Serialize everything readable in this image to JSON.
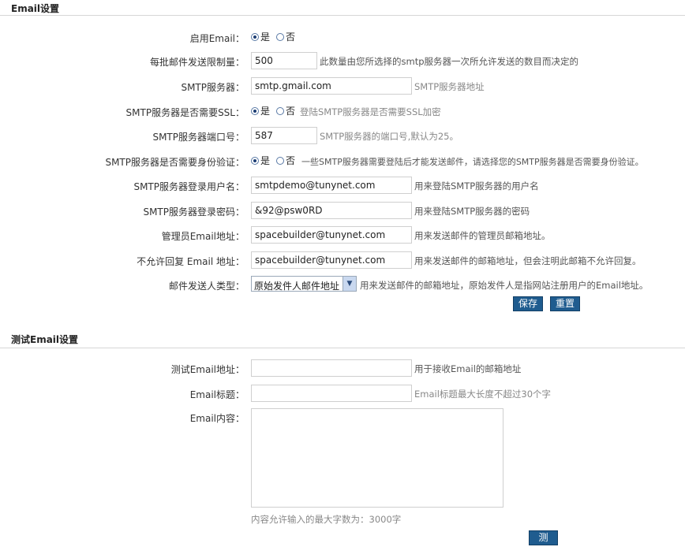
{
  "email_settings": {
    "section_title": "Email设置",
    "enable": {
      "label": "启用Email：",
      "options": [
        "是",
        "否"
      ],
      "selected": 0
    },
    "batch_limit": {
      "label": "每批邮件发送限制量：",
      "value": "500",
      "hint": "此数量由您所选择的smtp服务器一次所允许发送的数目而决定的"
    },
    "smtp_server": {
      "label": "SMTP服务器：",
      "value": "smtp.gmail.com",
      "hint": "SMTP服务器地址"
    },
    "ssl": {
      "label": "SMTP服务器是否需要SSL：",
      "options": [
        "是",
        "否"
      ],
      "selected": 0,
      "hint": "登陆SMTP服务器是否需要SSL加密"
    },
    "port": {
      "label": "SMTP服务器端口号：",
      "value": "587",
      "hint": "SMTP服务器的端口号,默认为25。"
    },
    "auth": {
      "label": "SMTP服务器是否需要身份验证：",
      "options": [
        "是",
        "否"
      ],
      "selected": 0,
      "hint": "一些SMTP服务器需要登陆后才能发送邮件，请选择您的SMTP服务器是否需要身份验证。"
    },
    "username": {
      "label": "SMTP服务器登录用户名：",
      "value": "smtpdemo@tunynet.com",
      "hint": "用来登陆SMTP服务器的用户名"
    },
    "password": {
      "label": "SMTP服务器登录密码：",
      "value": "&92@psw0RD",
      "hint": "用来登陆SMTP服务器的密码"
    },
    "admin_email": {
      "label": "管理员Email地址：",
      "value": "spacebuilder@tunynet.com",
      "hint": "用来发送邮件的管理员邮箱地址。"
    },
    "noreply_email": {
      "label": "不允许回复 Email 地址：",
      "value": "spacebuilder@tunynet.com",
      "hint": "用来发送邮件的邮箱地址，但会注明此邮箱不允许回复。"
    },
    "sender_type": {
      "label": "邮件发送人类型：",
      "selected": "原始发件人邮件地址",
      "hint": "用来发送邮件的邮箱地址，原始发件人是指网站注册用户的Email地址。"
    },
    "save_label": "保存",
    "reset_label": "重置"
  },
  "test_settings": {
    "section_title": "测试Email设置",
    "test_address": {
      "label": "测试Email地址：",
      "value": "",
      "hint": "用于接收Email的邮箱地址"
    },
    "subject": {
      "label": "Email标题：",
      "value": "",
      "hint": "Email标题最大长度不超过30个字"
    },
    "content": {
      "label": "Email内容：",
      "value": "",
      "note": "内容允许输入的最大字数为：3000字"
    },
    "test_label": "测试"
  },
  "icons": {
    "radio": "radio-circle",
    "dropdown": "chevron-down-icon"
  },
  "colors": {
    "button_bg": "#1f5c8f",
    "hint_text": "#888888",
    "border": "#cfcfcf"
  }
}
